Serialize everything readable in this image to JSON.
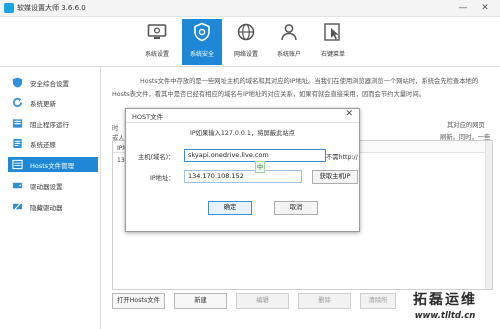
{
  "window": {
    "title": "软媒设置大师 3.6.6.0",
    "min_glyph": "—",
    "close_glyph": "✕"
  },
  "toolbar": {
    "items": [
      {
        "label": "系统设置",
        "icon": "desktop-gear-icon"
      },
      {
        "label": "系统安全",
        "icon": "shield-gear-icon"
      },
      {
        "label": "网络设置",
        "icon": "globe-icon"
      },
      {
        "label": "系统账户",
        "icon": "user-icon"
      },
      {
        "label": "右键菜单",
        "icon": "cursor-icon"
      }
    ],
    "active_index": 1,
    "accent": "#1e88d6"
  },
  "sidebar": {
    "items": [
      {
        "label": "安全综合设置",
        "icon": "shield-icon"
      },
      {
        "label": "系统更新",
        "icon": "refresh-icon"
      },
      {
        "label": "阻止程序运行",
        "icon": "block-icon"
      },
      {
        "label": "系统还原",
        "icon": "restore-icon"
      },
      {
        "label": "Hosts文件管理",
        "icon": "hosts-file-icon"
      },
      {
        "label": "驱动器设置",
        "icon": "drive-icon"
      },
      {
        "label": "隐藏驱动器",
        "icon": "hidden-drive-icon"
      }
    ],
    "active_index": 4
  },
  "main": {
    "description": "Hosts文件中存放的是一些网址主机的域名和其对应的IP地址。当我们在使用浏览器浏览一个网站时，系统会先检查本地的Hosts表文件，看其中是否已经有相应的域名与IP地址的对应关系，如果有就会直接采用，因而会节约大量时间。",
    "desc_cut1": "时",
    "desc_cut1_right": "其对应的网页",
    "desc_cut2": "质",
    "desc_cut2_right": "刷新。同时，一些",
    "desc_cut3": "或人",
    "table": {
      "header": "IP地",
      "first_cell": "134"
    },
    "buttons": [
      {
        "label": "打开Hosts文件",
        "enabled": true
      },
      {
        "label": "新建",
        "enabled": true
      },
      {
        "label": "编辑",
        "enabled": false
      },
      {
        "label": "删除",
        "enabled": false
      },
      {
        "label": "清除所",
        "enabled": false
      }
    ]
  },
  "dialog": {
    "title": "HOST文件",
    "close_glyph": "✕",
    "hint": "IP如果输入127.0.0.1，将屏蔽此站点",
    "domain_label": "主机(域名)：",
    "domain_value": "skyapi.onedrive.live.com",
    "no_http_note": "不需http://",
    "ip_label": "IP地址：",
    "ip_value": "134.170.108.152",
    "ime_glyph": "中",
    "get_ip_label": "获取主机IP",
    "ok_label": "确定",
    "cancel_label": "取消"
  },
  "watermark": {
    "brand": "拓磊运维",
    "url": "www.tlltd.cn"
  }
}
